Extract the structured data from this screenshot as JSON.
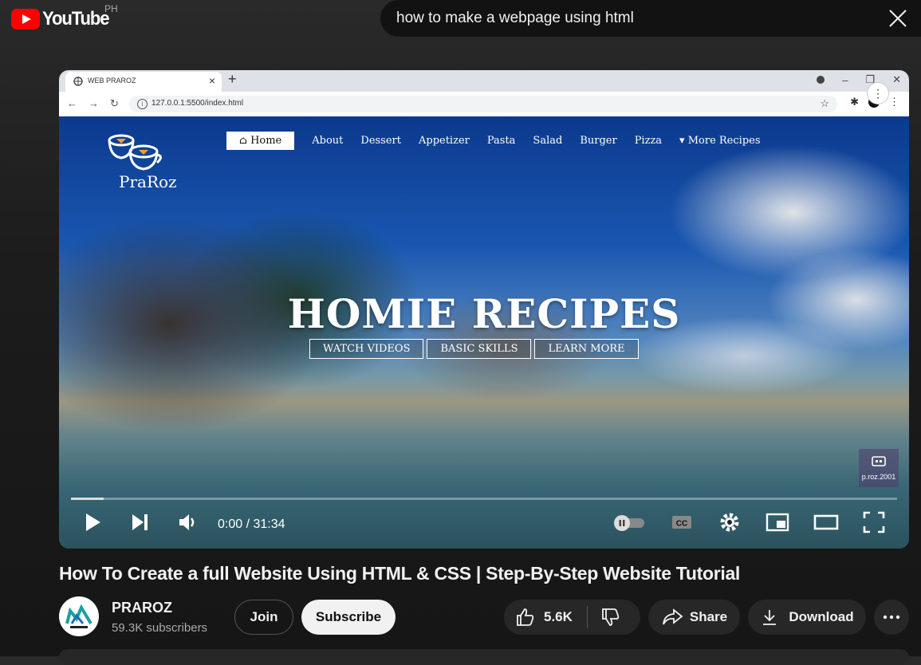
{
  "header": {
    "logo_text": "YouTube",
    "country": "PH",
    "search_value": "how to make a webpage using html"
  },
  "browser": {
    "tab_title": "WEB PRAROZ",
    "url": "127.0.0.1:5500/index.html"
  },
  "site": {
    "brand": "PraRoz",
    "nav": [
      "Home",
      "About",
      "Dessert",
      "Appetizer",
      "Pasta",
      "Salad",
      "Burger",
      "Pizza",
      "More Recipes"
    ],
    "hero_title": "HOMIE RECIPES",
    "hero_buttons": [
      "WATCH VIDEOS",
      "BASIC SKILLS",
      "LEARN MORE"
    ],
    "watermark": "p.roz.2001"
  },
  "player": {
    "time": "0:00 / 31:34",
    "progress": 0.04
  },
  "video": {
    "title": "How To Create a full Website Using HTML & CSS | Step-By-Step Website Tutorial",
    "channel": "PRAROZ",
    "subscribers": "59.3K subscribers",
    "join_label": "Join",
    "subscribe_label": "Subscribe",
    "likes": "5.6K",
    "share_label": "Share",
    "download_label": "Download"
  }
}
